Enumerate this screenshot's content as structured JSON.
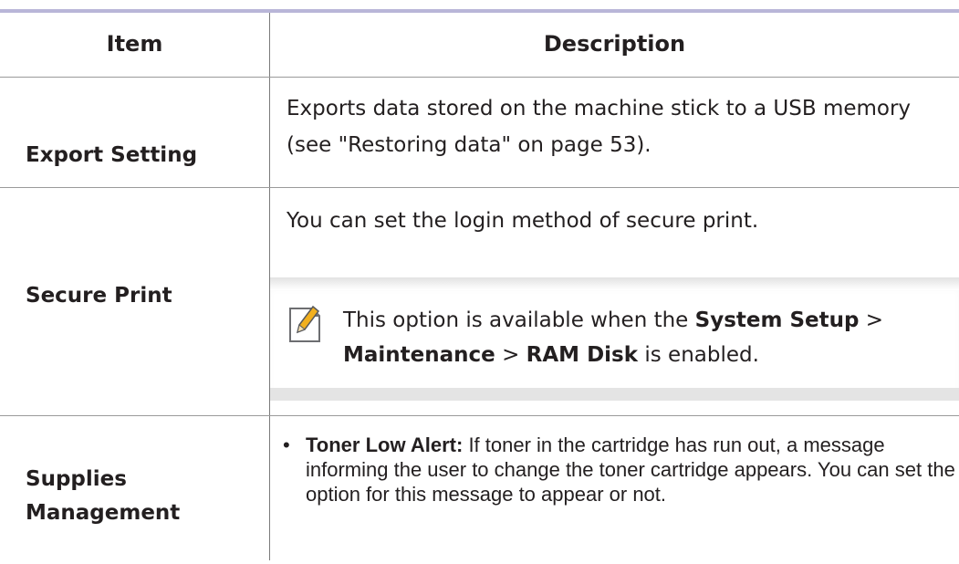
{
  "table": {
    "headers": {
      "item": "Item",
      "description": "Description"
    },
    "rows": [
      {
        "item": "Export Setting",
        "description": "Exports data stored on the machine stick to a USB memory (see \"Restoring data\" on page 53)."
      },
      {
        "item": "Secure Print",
        "description": "You can set the login method of secure print.",
        "note": {
          "icon": "note-pencil-icon",
          "text_prefix": "This option is available  when the ",
          "bold_1": "System Setup",
          "sep_1": " > ",
          "bold_2": "Maintenance",
          "sep_2": " > ",
          "bold_3": "RAM Disk",
          "text_suffix": " is enabled."
        }
      },
      {
        "item_line1": "Supplies",
        "item_line2": "Management",
        "bullets": [
          {
            "bullet": "•",
            "bold": "Toner Low Alert:",
            "text": " If toner in the cartridge has run out, a message informing the user to change the toner cartridge appears. You can set the option for this message to appear or not."
          }
        ]
      }
    ]
  },
  "colors": {
    "top_rule": "#b9b6d8",
    "text": "#231f20",
    "note_icon_accent": "#f2b01e"
  }
}
